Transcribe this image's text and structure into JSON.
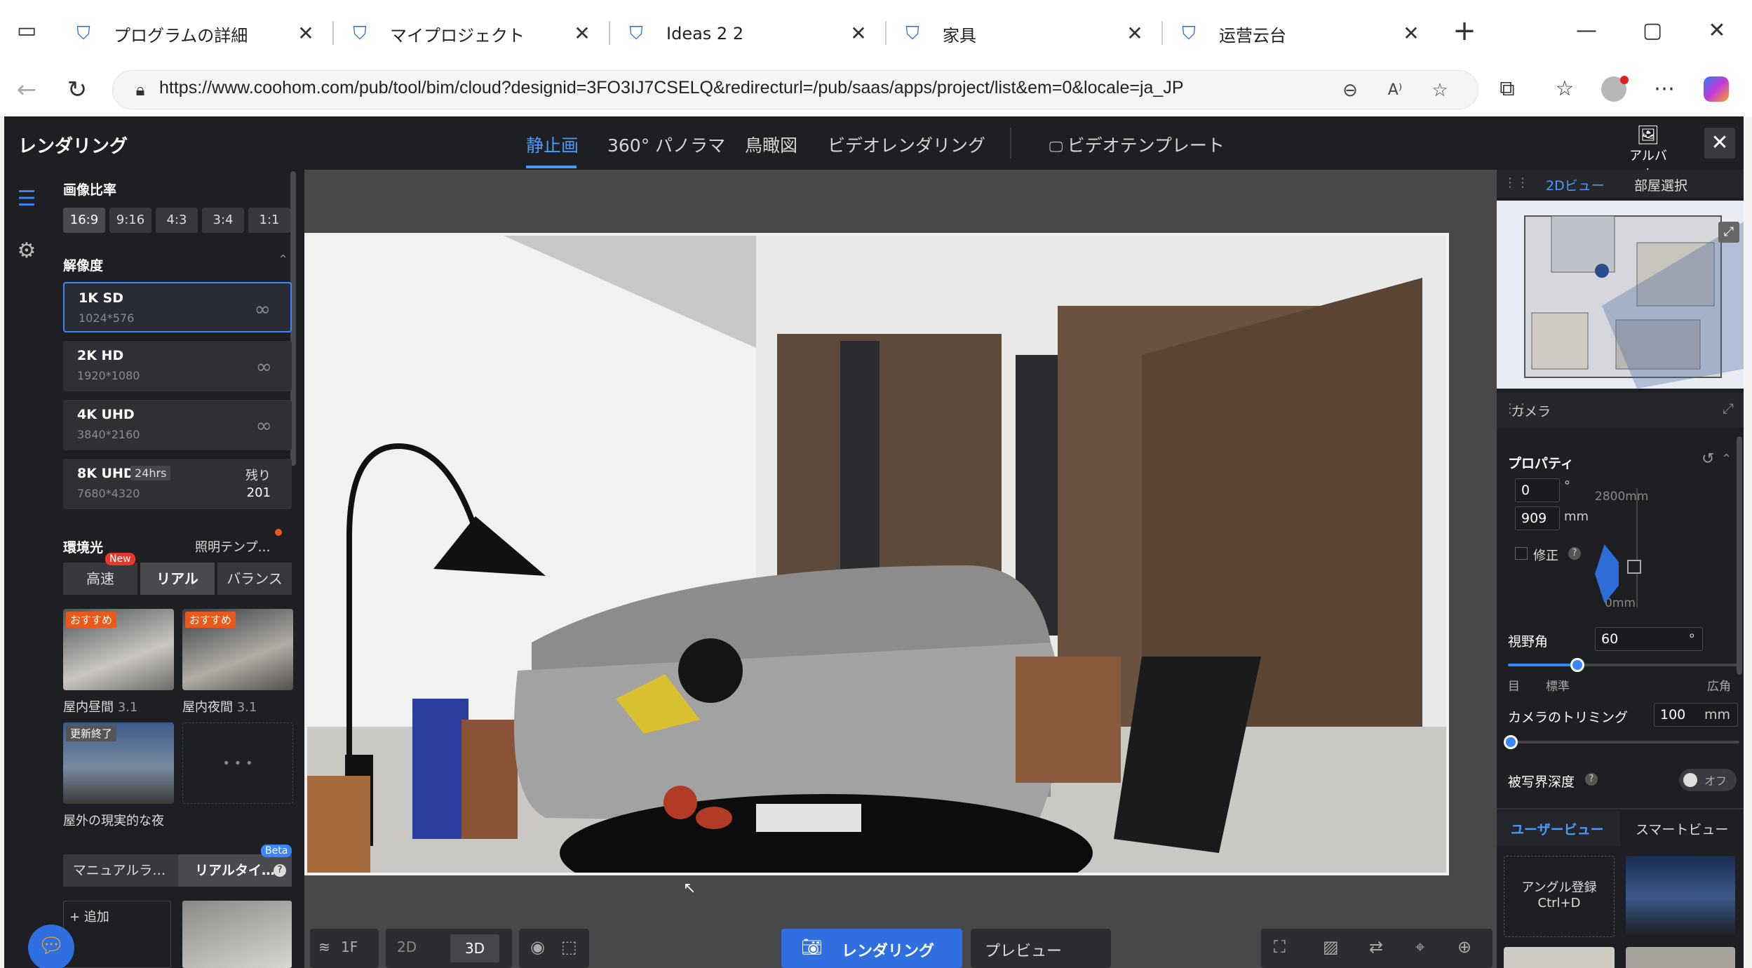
{
  "browser": {
    "tabs": [
      {
        "label": "プログラムの詳細"
      },
      {
        "label": "マイプロジェクト"
      },
      {
        "label": "Ideas 2 2"
      },
      {
        "label": "家具"
      },
      {
        "label": "运营云台"
      }
    ],
    "new_tab": "+",
    "url": "https://www.coohom.com/pub/tool/bim/cloud?designid=3FO3IJ7CSELQ&redirecturl=/pub/saas/apps/project/list&em=0&locale=ja_JP"
  },
  "app": {
    "title": "レンダリング",
    "mode_tabs": [
      "静止画",
      "360° パノラマ",
      "鳥瞰図",
      "ビデオレンダリング"
    ],
    "video_template": "ビデオテンプレート",
    "album": "アルバム"
  },
  "left": {
    "aspect_title": "画像比率",
    "aspect_ratios": [
      "16:9",
      "9:16",
      "4:3",
      "3:4",
      "1:1"
    ],
    "resolution_title": "解像度",
    "resolutions": [
      {
        "name": "1K SD",
        "size": "1024*576"
      },
      {
        "name": "2K HD",
        "size": "1920*1080"
      },
      {
        "name": "4K UHD",
        "size": "3840*2160"
      },
      {
        "name": "8K UHD",
        "size": "7680*4320",
        "badge": "24hrs",
        "remain_label": "残り",
        "remain_value": "201"
      }
    ],
    "env_title": "環境光",
    "env_template": "照明テンプ…",
    "env_tabs": [
      "高速",
      "リアル",
      "バランス"
    ],
    "new_badge": "New",
    "presets": [
      {
        "tag": "おすすめ",
        "name": "屋内昼間",
        "version": "3.1"
      },
      {
        "tag": "おすすめ",
        "name": "屋内夜間",
        "version": "3.1"
      },
      {
        "tag": "更新終了",
        "name": "屋外の現実的な夜"
      }
    ],
    "more": "• • •",
    "light_tabs": [
      "マニュアルラ…",
      "リアルタイ…"
    ],
    "beta": "Beta",
    "add": "+ 追加",
    "help_icon": "?"
  },
  "viewport": {
    "floor": "1F",
    "view2d": "2D",
    "view3d": "3D",
    "render_button": "レンダリング",
    "preview": "プレビュー"
  },
  "right": {
    "map_tabs": [
      "2Dビュー",
      "部屋選択"
    ],
    "camera": "カメラ",
    "properties": "プロパティ",
    "angle_value": "0",
    "angle_unit": "°",
    "height_value": "909",
    "height_unit": "mm",
    "correct": "修正",
    "max_height": "2800mm",
    "min_height": "0mm",
    "fov_label": "視野角",
    "fov_value": "60",
    "fov_unit": "°",
    "fov_marks": [
      "目",
      "標準",
      "広角"
    ],
    "fov_level": 0.3,
    "crop_label": "カメラのトリミング",
    "crop_value": "100",
    "crop_unit": "mm",
    "dof_label": "被写界深度",
    "dof_state": "オフ",
    "view_tabs": [
      "ユーザービュー",
      "スマートビュー"
    ],
    "angle_register": "アングル登録",
    "shortcut": "Ctrl+D"
  },
  "colors": {
    "accent": "#3a86ff",
    "panel": "#1e1f22",
    "orange": "#e8591a"
  }
}
